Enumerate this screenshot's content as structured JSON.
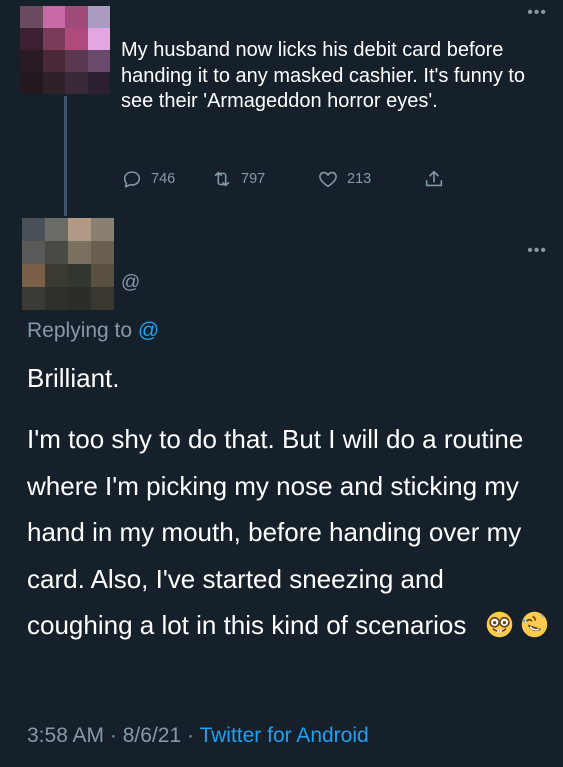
{
  "parent_tweet": {
    "text": "My husband now licks his debit card before handing it to any masked cashier. It's funny to see their 'Armageddon horror eyes'.",
    "more_icon": "•••",
    "actions": {
      "reply_count": "746",
      "retweet_count": "797",
      "like_count": "213"
    }
  },
  "reply_tweet": {
    "handle": "@",
    "more_icon": "•••",
    "replying_prefix": "Replying to",
    "replying_handle": "@",
    "first_line": "Brilliant.",
    "body": "I'm too shy to do that. But I will do a routine where I'm picking my nose and sticking my hand in my mouth, before handing over my card. Also, I've started sneezing and coughing a lot in this kind of scenarios",
    "emojis": [
      "nerd-face-emoji",
      "rolling-on-floor-laughing-emoji"
    ]
  },
  "footer": {
    "time": "3:58 AM",
    "sep1": "·",
    "date": "8/6/21",
    "sep2": "·",
    "source": "Twitter for Android"
  },
  "colors": {
    "background": "#15202b",
    "text": "#ffffff",
    "secondary_text": "#8899a6",
    "link": "#1da1f2"
  },
  "avatars": {
    "parent": [
      "#6a4a5e",
      "#c86aa6",
      "#a04a7a",
      "#a99cc0",
      "#3a2030",
      "#7a3a5a",
      "#b04a7a",
      "#e4a6e0",
      "#2a1a24",
      "#4a2838",
      "#5a3850",
      "#6a4a6a",
      "#241820",
      "#2e2028",
      "#3a2a38",
      "#2a2030"
    ],
    "reply": [
      "#4a5058",
      "#6a6a66",
      "#b09a86",
      "#8a8072",
      "#5a5a58",
      "#4a4a44",
      "#7a7060",
      "#6a6050",
      "#7a6048",
      "#3a3a30",
      "#32362e",
      "#5a5040",
      "#3a3a36",
      "#2e302a",
      "#2a2e26",
      "#3a3630"
    ]
  }
}
